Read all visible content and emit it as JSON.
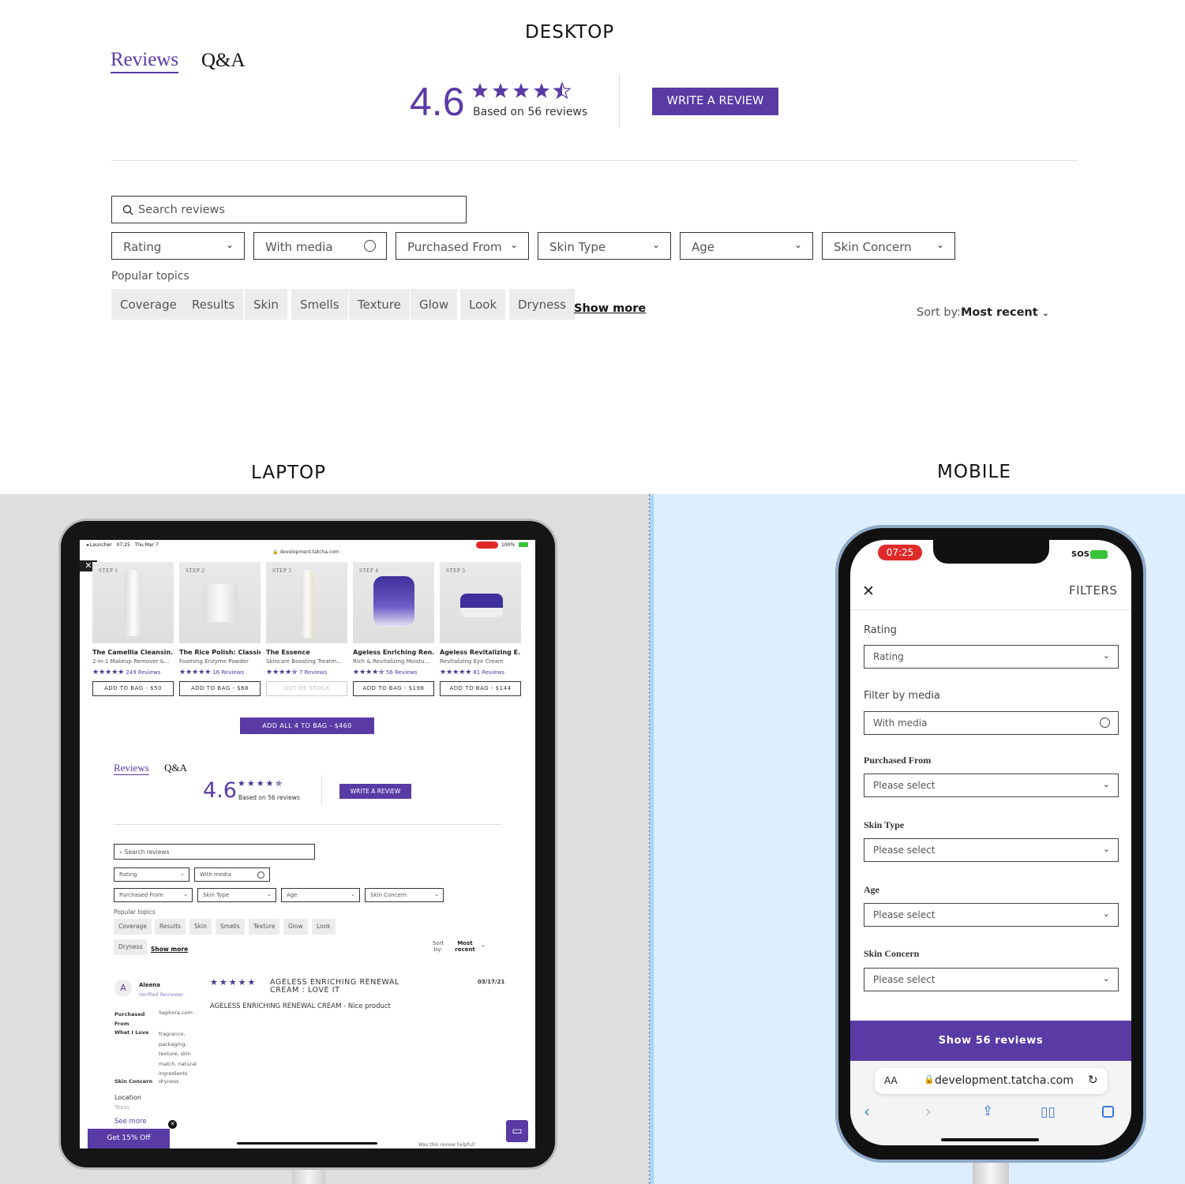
{
  "labels": {
    "desktop": "DESKTOP",
    "laptop": "LAPTOP",
    "mobile": "MOBILE"
  },
  "colors": {
    "accent": "#5a3aa5",
    "laptop_bg": "#dedede",
    "mobile_bg": "#ddeeff"
  },
  "desktop": {
    "tabs": {
      "reviews": "Reviews",
      "qa": "Q&A"
    },
    "rating": "4.6",
    "stars": 4.5,
    "based_on": "Based on 56 reviews",
    "write_review": "WRITE A REVIEW",
    "search_placeholder": "Search reviews",
    "filters": {
      "rating": "Rating",
      "media": "With media",
      "purchased": "Purchased From",
      "skin_type": "Skin Type",
      "age": "Age",
      "skin_concern": "Skin Concern"
    },
    "popular_topics": "Popular topics",
    "chips": [
      "Coverage",
      "Results",
      "Skin",
      "Smells",
      "Texture",
      "Glow",
      "Look",
      "Dryness"
    ],
    "show_more": "Show more",
    "sort_label": "Sort by:",
    "sort_value": "Most recent"
  },
  "laptop": {
    "status": {
      "left": "◂ Launcher   07:25   Thu Mar 7",
      "url": "development.tatcha.com",
      "battery": "100%"
    },
    "products": [
      {
        "step": "STEP 1",
        "name": "The Camellia Cleansin...",
        "sub": "2-in-1 Makeup Remover &...",
        "reviews": "249 Reviews",
        "button": "ADD TO BAG - $50"
      },
      {
        "step": "STEP 2",
        "name": "The Rice Polish: Classic",
        "sub": "Foaming Enzyme Powder",
        "reviews": "16 Reviews",
        "button": "ADD TO BAG - $68"
      },
      {
        "step": "STEP 3",
        "name": "The Essence",
        "sub": "Skincare Boosting Treatm...",
        "reviews": "7 Reviews",
        "button": "OUT OF STOCK"
      },
      {
        "step": "STEP 4",
        "name": "Ageless Enriching Ren...",
        "sub": "Rich & Revitalizing Moistu...",
        "reviews": "56 Reviews",
        "button": "ADD TO BAG - $198"
      },
      {
        "step": "STEP 5",
        "name": "Ageless Revitalizing E...",
        "sub": "Revitalizing Eye Cream",
        "reviews": "81 Reviews",
        "button": "ADD TO BAG - $144"
      }
    ],
    "add_all": "ADD ALL 4 TO BAG - $460",
    "tabs": {
      "reviews": "Reviews",
      "qa": "Q&A"
    },
    "rating": "4.6",
    "based_on": "Based on 56 reviews",
    "write_review": "WRITE A REVIEW",
    "search_placeholder": "Search reviews",
    "filters": {
      "rating": "Rating",
      "media": "With media",
      "purchased": "Purchased From",
      "skin_type": "Skin Type",
      "age": "Age",
      "skin_concern": "Skin Concern"
    },
    "popular_topics": "Popular topics",
    "chips": [
      "Coverage",
      "Results",
      "Skin",
      "Smells",
      "Texture",
      "Glow",
      "Look",
      "Dryness"
    ],
    "show_more": "Show more",
    "sort_label": "Sort by:",
    "sort_value": "Most recent",
    "review": {
      "avatar": "A",
      "name": "Aleena",
      "verified": "Verified Reviewer",
      "title": "AGELESS ENRICHING RENEWAL CREAM : LOVE IT",
      "date": "03/17/21",
      "body": "AGELESS ENRICHING RENEWAL CREAM - Nice product",
      "purchased_label": "Purchased From",
      "purchased_value": "Sephora.com",
      "love_label": "What I Love",
      "love_value": "fragrance, packaging, texture, skin match, natural ingredients",
      "concern_label": "Skin Concern",
      "concern_value": "dryness",
      "location_label": "Location",
      "location_value": "Texas",
      "see_more": "See more",
      "helpful": "Was this review helpful?"
    },
    "promo": "Get 15% Off"
  },
  "mobile": {
    "time": "07:25",
    "signal": "SOS",
    "title": "FILTERS",
    "rating_label": "Rating",
    "rating_value": "Rating",
    "media_label": "Filter by media",
    "media_value": "With media",
    "purchased_label": "Purchased From",
    "skin_type_label": "Skin Type",
    "age_label": "Age",
    "concern_label": "Skin Concern",
    "placeholder": "Please select",
    "show_button": "Show 56 reviews",
    "url": "development.tatcha.com",
    "text_size": "AA"
  }
}
